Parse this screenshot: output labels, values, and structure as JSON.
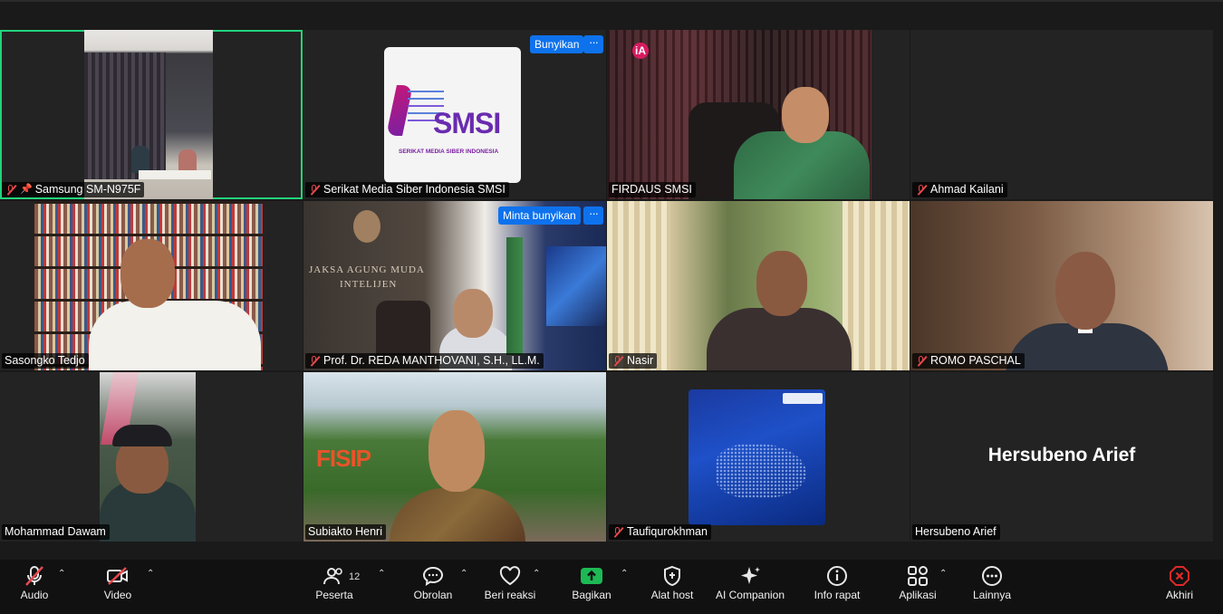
{
  "participants": [
    {
      "name": "Samsung SM-N975F",
      "muted": true,
      "pinned": true,
      "active": true
    },
    {
      "name": "Serikat Media Siber Indonesia SMSI",
      "muted": true,
      "button": "Bunyikan"
    },
    {
      "name": "FIRDAUS SMSI",
      "muted": false
    },
    {
      "name": "Ahmad Kailani",
      "muted": true
    },
    {
      "name": "Sasongko Tedjo",
      "muted": false
    },
    {
      "name": "Prof. Dr. REDA MANTHOVANI, S.H., LL.M.",
      "muted": true,
      "button": "Minta bunyikan"
    },
    {
      "name": "Nasir",
      "muted": true
    },
    {
      "name": "ROMO PASCHAL",
      "muted": true
    },
    {
      "name": "Mohammad Dawam",
      "muted": false
    },
    {
      "name": "Subiakto Henri",
      "muted": false
    },
    {
      "name": "Taufiqurokhman",
      "muted": true
    },
    {
      "name": "Hersubeno Arief",
      "muted": false,
      "big_name": "Hersubeno Arief"
    }
  ],
  "logos": {
    "smsi_main": "SMSI",
    "smsi_sub": "SERIKAT MEDIA SIBER INDONESIA",
    "ia": "iA",
    "wall_text_1": "JAKSA AGUNG MUDA",
    "wall_text_2": "INTELIJEN",
    "fisip": "FISIP"
  },
  "toolbar": {
    "audio": "Audio",
    "video": "Video",
    "participants": "Peserta",
    "participants_count": "12",
    "chat": "Obrolan",
    "reactions": "Beri reaksi",
    "share": "Bagikan",
    "host_tools": "Alat host",
    "ai_companion": "AI Companion",
    "meeting_info": "Info rapat",
    "apps": "Aplikasi",
    "more": "Lainnya",
    "end": "Akhiri"
  },
  "colors": {
    "active_border": "#22d37d",
    "accent_blue": "#0e72ed",
    "muted_red": "#e5484d",
    "share_green": "#1db954",
    "end_red": "#e02828"
  }
}
